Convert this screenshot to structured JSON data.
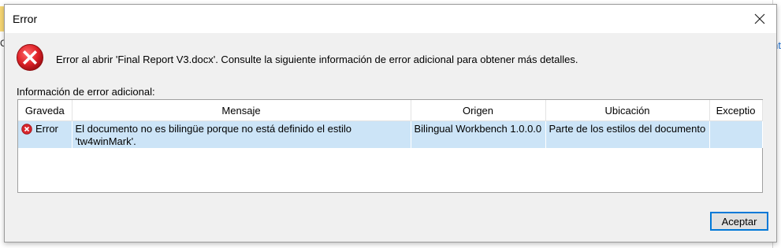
{
  "background": {
    "left_text": "C",
    "right_text": "nt"
  },
  "dialog": {
    "title": "Error",
    "message": "Error al abrir 'Final Report V3.docx'. Consulte la siguiente información de error adicional para obtener más detalles.",
    "info_label": "Información de error adicional:",
    "columns": [
      "Graveda",
      "Mensaje",
      "Origen",
      "Ubicación",
      "Exceptio"
    ],
    "rows": [
      {
        "severity": "Error",
        "message": "El documento no es bilingüe porque no está definido el estilo 'tw4winMark'.",
        "origin": "Bilingual Workbench 1.0.0.0",
        "location": "Parte de los estilos del documento",
        "exception": ""
      }
    ],
    "ok_label": "Aceptar"
  },
  "colors": {
    "error_red": "#e81123",
    "selection": "#cce4f7",
    "focus_blue": "#0078d7"
  },
  "icons": {
    "error": "error-circle-icon",
    "close": "close-icon"
  }
}
